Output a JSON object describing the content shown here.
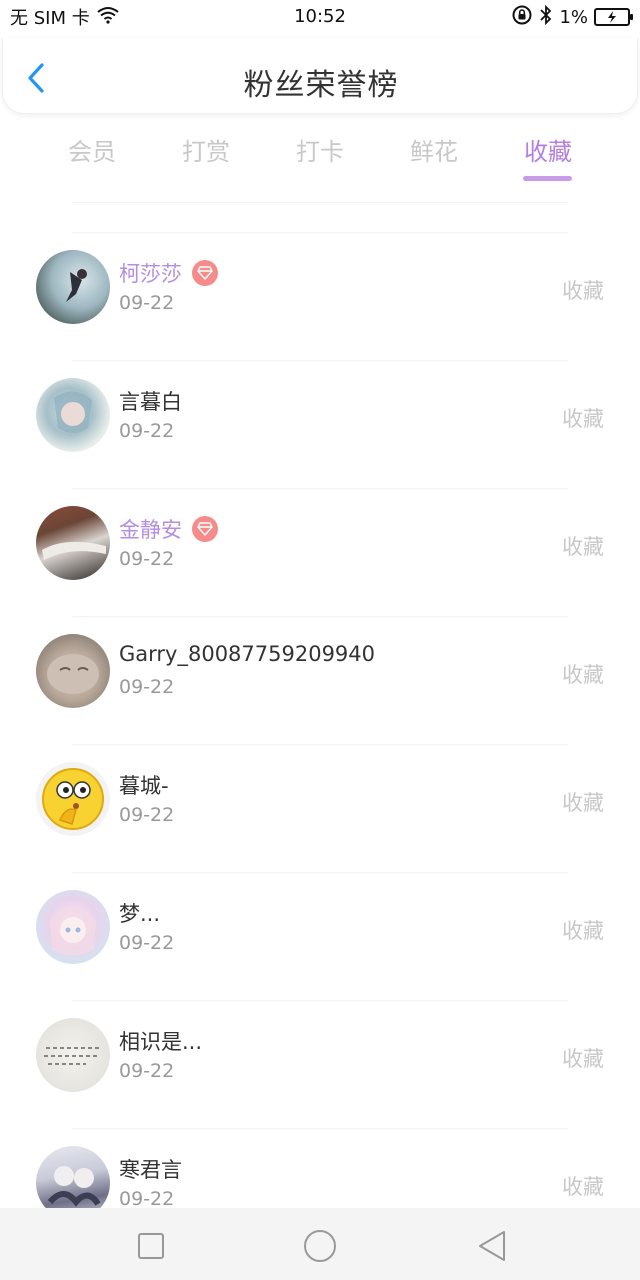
{
  "status_bar": {
    "carrier": "无 SIM 卡",
    "time": "10:52",
    "battery": "1%"
  },
  "header": {
    "title": "粉丝荣誉榜"
  },
  "tabs": [
    {
      "label": "会员"
    },
    {
      "label": "打赏"
    },
    {
      "label": "打卡"
    },
    {
      "label": "鲜花"
    },
    {
      "label": "收藏",
      "active": true
    }
  ],
  "list": [
    {
      "name": "柯莎莎",
      "date": "09-22",
      "action": "收藏",
      "vip": true
    },
    {
      "name": "言暮白",
      "date": "09-22",
      "action": "收藏",
      "vip": false
    },
    {
      "name": "金静安",
      "date": "09-22",
      "action": "收藏",
      "vip": true
    },
    {
      "name": "Garry_80087759209940",
      "date": "09-22",
      "action": "收藏",
      "vip": false
    },
    {
      "name": "暮城-",
      "date": "09-22",
      "action": "收藏",
      "vip": false
    },
    {
      "name": "梦...",
      "date": "09-22",
      "action": "收藏",
      "vip": false
    },
    {
      "name": "相识是...",
      "date": "09-22",
      "action": "收藏",
      "vip": false
    },
    {
      "name": "寒君言",
      "date": "09-22",
      "action": "收藏",
      "vip": false
    }
  ],
  "colors": {
    "accent": "#b47fe0",
    "vip_name": "#b48ee0",
    "badge": "#f58b8b",
    "back_arrow": "#2196f3"
  },
  "icons": {
    "back": "chevron-left-icon",
    "badge": "diamond-icon",
    "nav_recent": "square-icon",
    "nav_home": "circle-icon",
    "nav_back": "triangle-back-icon"
  }
}
